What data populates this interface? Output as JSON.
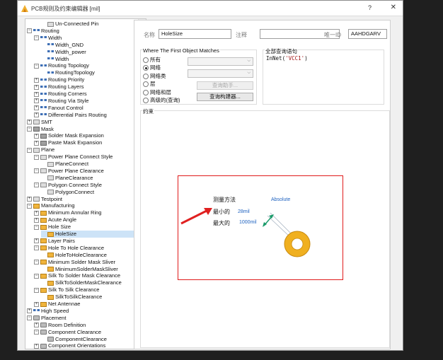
{
  "window": {
    "title": "PCB规则及约束编辑器 [mil]",
    "help": "?",
    "close": "✕"
  },
  "tree": {
    "items": [
      {
        "label": "Un-Connected Pin",
        "indent": 3,
        "toggle": "",
        "icon": "rule"
      },
      {
        "label": "Routing",
        "indent": 1,
        "toggle": "−",
        "icon": "route"
      },
      {
        "label": "Width",
        "indent": 2,
        "toggle": "−",
        "icon": "route"
      },
      {
        "label": "Width_GND",
        "indent": 3,
        "toggle": "",
        "icon": "route"
      },
      {
        "label": "Width_power",
        "indent": 3,
        "toggle": "",
        "icon": "route"
      },
      {
        "label": "Width",
        "indent": 3,
        "toggle": "",
        "icon": "route"
      },
      {
        "label": "Routing Topology",
        "indent": 2,
        "toggle": "−",
        "icon": "route"
      },
      {
        "label": "RoutingTopology",
        "indent": 3,
        "toggle": "",
        "icon": "route"
      },
      {
        "label": "Routing Priority",
        "indent": 2,
        "toggle": "+",
        "icon": "route"
      },
      {
        "label": "Routing Layers",
        "indent": 2,
        "toggle": "+",
        "icon": "route"
      },
      {
        "label": "Routing Corners",
        "indent": 2,
        "toggle": "+",
        "icon": "route"
      },
      {
        "label": "Routing Via Style",
        "indent": 2,
        "toggle": "+",
        "icon": "route"
      },
      {
        "label": "Fanout Control",
        "indent": 2,
        "toggle": "+",
        "icon": "route"
      },
      {
        "label": "Differential Pairs Routing",
        "indent": 2,
        "toggle": "+",
        "icon": "route"
      },
      {
        "label": "SMT",
        "indent": 1,
        "toggle": "+",
        "icon": "rule"
      },
      {
        "label": "Mask",
        "indent": 1,
        "toggle": "−",
        "icon": "mask"
      },
      {
        "label": "Solder Mask Expansion",
        "indent": 2,
        "toggle": "+",
        "icon": "mask"
      },
      {
        "label": "Paste Mask Expansion",
        "indent": 2,
        "toggle": "+",
        "icon": "mask"
      },
      {
        "label": "Plane",
        "indent": 1,
        "toggle": "−",
        "icon": "rule"
      },
      {
        "label": "Power Plane Connect Style",
        "indent": 2,
        "toggle": "−",
        "icon": "rule"
      },
      {
        "label": "PlaneConnect",
        "indent": 3,
        "toggle": "",
        "icon": "rule"
      },
      {
        "label": "Power Plane Clearance",
        "indent": 2,
        "toggle": "−",
        "icon": "rule"
      },
      {
        "label": "PlaneClearance",
        "indent": 3,
        "toggle": "",
        "icon": "rule"
      },
      {
        "label": "Polygon Connect Style",
        "indent": 2,
        "toggle": "−",
        "icon": "rule"
      },
      {
        "label": "PolygonConnect",
        "indent": 3,
        "toggle": "",
        "icon": "rule"
      },
      {
        "label": "Testpoint",
        "indent": 1,
        "toggle": "+",
        "icon": "rule"
      },
      {
        "label": "Manufacturing",
        "indent": 1,
        "toggle": "−",
        "icon": "mfg"
      },
      {
        "label": "Minimum Annular Ring",
        "indent": 2,
        "toggle": "+",
        "icon": "mfg"
      },
      {
        "label": "Acute Angle",
        "indent": 2,
        "toggle": "+",
        "icon": "mfg"
      },
      {
        "label": "Hole Size",
        "indent": 2,
        "toggle": "−",
        "icon": "mfg"
      },
      {
        "label": "HoleSize",
        "indent": 3,
        "toggle": "",
        "icon": "mfg",
        "selected": true
      },
      {
        "label": "Layer Pairs",
        "indent": 2,
        "toggle": "+",
        "icon": "mfg"
      },
      {
        "label": "Hole To Hole Clearance",
        "indent": 2,
        "toggle": "−",
        "icon": "mfg"
      },
      {
        "label": "HoleToHoleClearance",
        "indent": 3,
        "toggle": "",
        "icon": "mfg"
      },
      {
        "label": "Minimum Solder Mask Sliver",
        "indent": 2,
        "toggle": "−",
        "icon": "mfg"
      },
      {
        "label": "MinimumSolderMaskSliver",
        "indent": 3,
        "toggle": "",
        "icon": "mfg"
      },
      {
        "label": "Silk To Solder Mask Clearance",
        "indent": 2,
        "toggle": "−",
        "icon": "mfg"
      },
      {
        "label": "SilkToSolderMaskClearance",
        "indent": 3,
        "toggle": "",
        "icon": "mfg"
      },
      {
        "label": "Silk To Silk Clearance",
        "indent": 2,
        "toggle": "−",
        "icon": "mfg"
      },
      {
        "label": "SilkToSilkClearance",
        "indent": 3,
        "toggle": "",
        "icon": "mfg"
      },
      {
        "label": "Net Antennae",
        "indent": 2,
        "toggle": "+",
        "icon": "mfg"
      },
      {
        "label": "High Speed",
        "indent": 1,
        "toggle": "+",
        "icon": "route"
      },
      {
        "label": "Placement",
        "indent": 1,
        "toggle": "−",
        "icon": "place"
      },
      {
        "label": "Room Definition",
        "indent": 2,
        "toggle": "+",
        "icon": "place"
      },
      {
        "label": "Component Clearance",
        "indent": 2,
        "toggle": "−",
        "icon": "place"
      },
      {
        "label": "ComponentClearance",
        "indent": 3,
        "toggle": "",
        "icon": "place"
      },
      {
        "label": "Component Orientations",
        "indent": 2,
        "toggle": "+",
        "icon": "place"
      }
    ]
  },
  "header": {
    "name_label": "名称",
    "name_value": "HoleSize",
    "comment_label": "注释",
    "comment_value": "",
    "uid_label": "唯一ID",
    "uid_value": "AAHDGARV"
  },
  "match": {
    "title": "Where The First Object Matches",
    "options": [
      {
        "label": "所有",
        "checked": false
      },
      {
        "label": "网络",
        "checked": true
      },
      {
        "label": "网络类",
        "checked": false
      },
      {
        "label": "层",
        "checked": false
      },
      {
        "label": "网络和层",
        "checked": false
      },
      {
        "label": "高级的(查询)",
        "checked": false
      }
    ],
    "query_helper_btn": "查询助手...",
    "query_builder_btn": "查询构建器..."
  },
  "full_query": {
    "title": "全部查询语句",
    "prefix": "InNet(",
    "string": "'VCC1'",
    "suffix": ")"
  },
  "constraints": {
    "title": "约束",
    "measure_label": "测量方法",
    "measure_value": "Absolute",
    "min_label": "最小的",
    "min_value": "28mil",
    "max_label": "最大的",
    "max_value": "1000mil"
  },
  "colors": {
    "highlight_border": "#e01b1b",
    "pad_ring": "#e8a71a",
    "dimension_arrow": "#1a9b6a",
    "value_blue": "#1e62c0"
  }
}
